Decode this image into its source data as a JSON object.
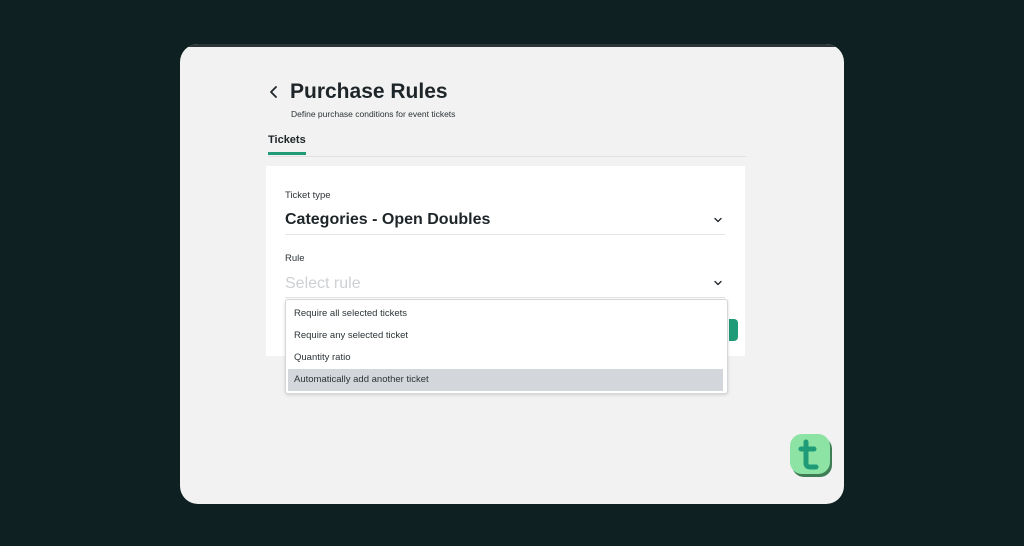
{
  "header": {
    "title": "Purchase Rules",
    "subtitle": "Define purchase conditions for event tickets"
  },
  "tabs": [
    {
      "label": "Tickets",
      "active": true
    }
  ],
  "form": {
    "ticket_type": {
      "label": "Ticket type",
      "value": "Categories - Open Doubles"
    },
    "rule": {
      "label": "Rule",
      "placeholder": "Select rule"
    }
  },
  "dropdown": {
    "options": [
      {
        "label": "Require all selected tickets"
      },
      {
        "label": "Require any selected ticket"
      },
      {
        "label": "Quantity ratio"
      },
      {
        "label": "Automatically add another ticket",
        "highlighted": true
      }
    ]
  },
  "colors": {
    "background": "#0e2022",
    "window": "#f2f2f2",
    "accent": "#1f9b77",
    "logo": "#8ce3a4",
    "highlight": "#d3d6da"
  },
  "icons": {
    "back": "chevron-left-icon",
    "select_toggle": "chevron-down-icon",
    "logo": "t-logo-icon"
  }
}
